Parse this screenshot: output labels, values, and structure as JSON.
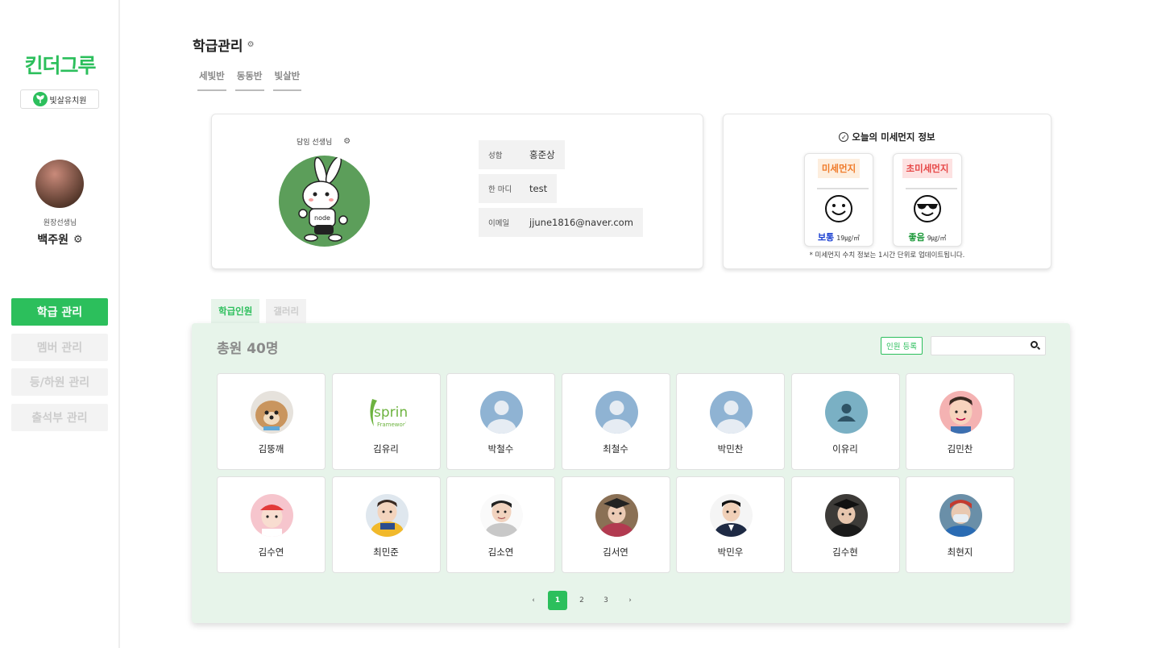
{
  "sidebar": {
    "logo": "킨더그루",
    "school": "빛살유치원",
    "role": "원장선생님",
    "user_name": "백주원",
    "nav": [
      {
        "label": "학급 관리",
        "active": true
      },
      {
        "label": "멤버 관리",
        "active": false
      },
      {
        "label": "등/하원 관리",
        "active": false
      },
      {
        "label": "출석부 관리",
        "active": false
      }
    ]
  },
  "header": {
    "title": "학급관리",
    "class_tabs": [
      "세빛반",
      "동동반",
      "빛살반"
    ]
  },
  "teacher": {
    "label": "담임 선생님",
    "rows": [
      {
        "key": "성함",
        "value": "홍준상"
      },
      {
        "key": "한 마디",
        "value": "test"
      },
      {
        "key": "이메일",
        "value": "jjune1816@naver.com"
      }
    ]
  },
  "dust": {
    "title": "오늘의 미세먼지 정보",
    "pm10": {
      "label": "미세먼지",
      "grade": "보통",
      "value": "19㎍/㎥",
      "grade_color": "#1a3fd1"
    },
    "pm25": {
      "label": "초미세먼지",
      "grade": "좋음",
      "value": "9㎍/㎥",
      "grade_color": "#1f9a3c"
    },
    "note": "* 미세먼지 수치 정보는 1시간 단위로 업데이트됩니다."
  },
  "panel": {
    "tabs": [
      "학급인원",
      "갤러리"
    ],
    "total": "총원 40명",
    "register_label": "인원 등록",
    "search_placeholder": "",
    "members": [
      {
        "name": "김뚱깨",
        "pic": "puppy"
      },
      {
        "name": "김유리",
        "pic": "spring"
      },
      {
        "name": "박철수",
        "pic": "default"
      },
      {
        "name": "최철수",
        "pic": "default"
      },
      {
        "name": "박민찬",
        "pic": "default"
      },
      {
        "name": "이유리",
        "pic": "default-dark"
      },
      {
        "name": "김민찬",
        "pic": "kid-pink"
      },
      {
        "name": "김수연",
        "pic": "kid-hat"
      },
      {
        "name": "최민준",
        "pic": "kid-yellow"
      },
      {
        "name": "김소연",
        "pic": "kid-white"
      },
      {
        "name": "김서연",
        "pic": "kid-grad"
      },
      {
        "name": "박민우",
        "pic": "kid-suit"
      },
      {
        "name": "김수현",
        "pic": "kid-grad2"
      },
      {
        "name": "최현지",
        "pic": "kid-mask"
      }
    ],
    "pages": [
      "‹",
      "1",
      "2",
      "3",
      "›"
    ],
    "current_page": "1"
  },
  "colors": {
    "brand": "#2cbf5c",
    "panel_bg": "#e7f4ea"
  }
}
